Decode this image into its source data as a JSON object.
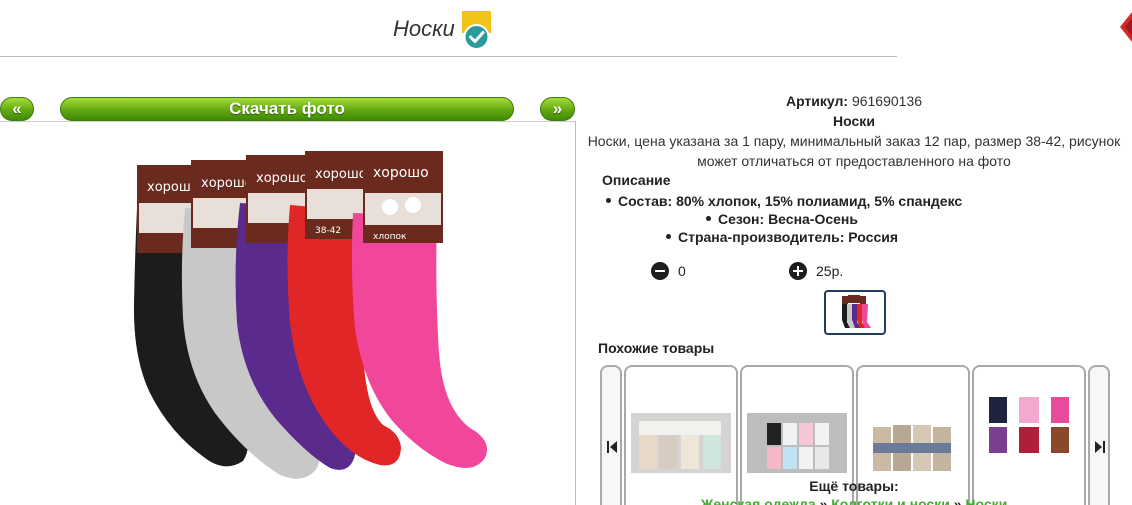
{
  "header": {
    "title": "Носки"
  },
  "nav": {
    "prev_label": "«",
    "download_label": "Скачать фото",
    "next_label": "»"
  },
  "product": {
    "article_label": "Артикул:",
    "article_value": "961690136",
    "name": "Носки",
    "description_line1": "Носки, цена указана за 1 пару, минимальный заказ 12 пар, размер 38-42, рисунок",
    "description_line2": "может отличаться от предоставленного на фото",
    "section_title": "Описание",
    "specs": [
      "Состав: 80% хлопок, 15% полиамид, 5% спандекс",
      "Сезон: Весна-Осень",
      "Страна-производитель: Россия"
    ],
    "quantity": "0",
    "price": "25р.",
    "package_label_top": "38-42",
    "brand": "хорошо",
    "package_label_bottom": "хлопок"
  },
  "similar": {
    "title": "Похожие товары"
  },
  "more": {
    "title": "Ещё товары:",
    "links": [
      "Женская одежда",
      "Колготки и носки",
      "Носки"
    ],
    "separator": "»"
  },
  "colors": {
    "accent_green": "#62a80f",
    "badge_yellow": "#f2c318",
    "badge_teal": "#2a9a9a",
    "close_red": "#d22a2a",
    "sock_colors": [
      "#1c1c1c",
      "#c8c8c8",
      "#5a2a8c",
      "#e02626",
      "#f0479a"
    ],
    "package_brown": "#6b2a1e"
  }
}
